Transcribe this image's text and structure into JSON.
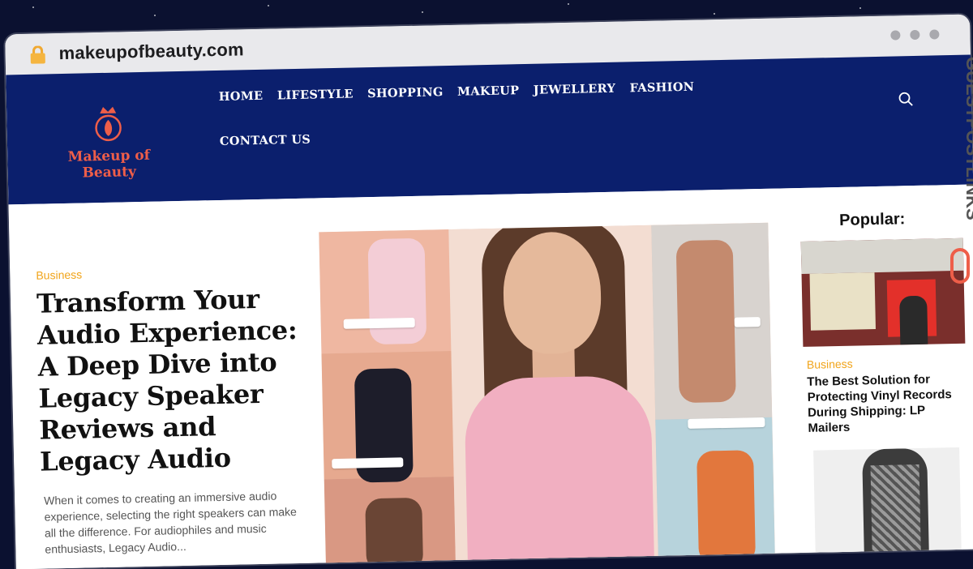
{
  "browser": {
    "url": "makeupofbeauty.com"
  },
  "site": {
    "logo_text": "Makeup of Beauty",
    "nav": [
      "HOME",
      "LIFESTYLE",
      "SHOPPING",
      "MAKEUP",
      "JEWELLERY",
      "FASHION",
      "CONTACT US"
    ]
  },
  "hero": {
    "category": "Business",
    "title": "Transform Your Audio Experience: A Deep Dive into Legacy Speaker Reviews and Legacy Audio",
    "excerpt": "When it comes to creating an immersive audio experience, selecting the right speakers can make all the difference. For audiophiles and music enthusiasts, Legacy Audio..."
  },
  "sidebar": {
    "title": "Popular:",
    "items": [
      {
        "category": "Business",
        "title": "The Best Solution for Protecting Vinyl Records During Shipping: LP Mailers"
      }
    ]
  },
  "watermark": "GUESTPOSTLINKS",
  "colors": {
    "header_bg": "#0b1f6d",
    "accent": "#f1a51c",
    "logo": "#ee5e49"
  }
}
